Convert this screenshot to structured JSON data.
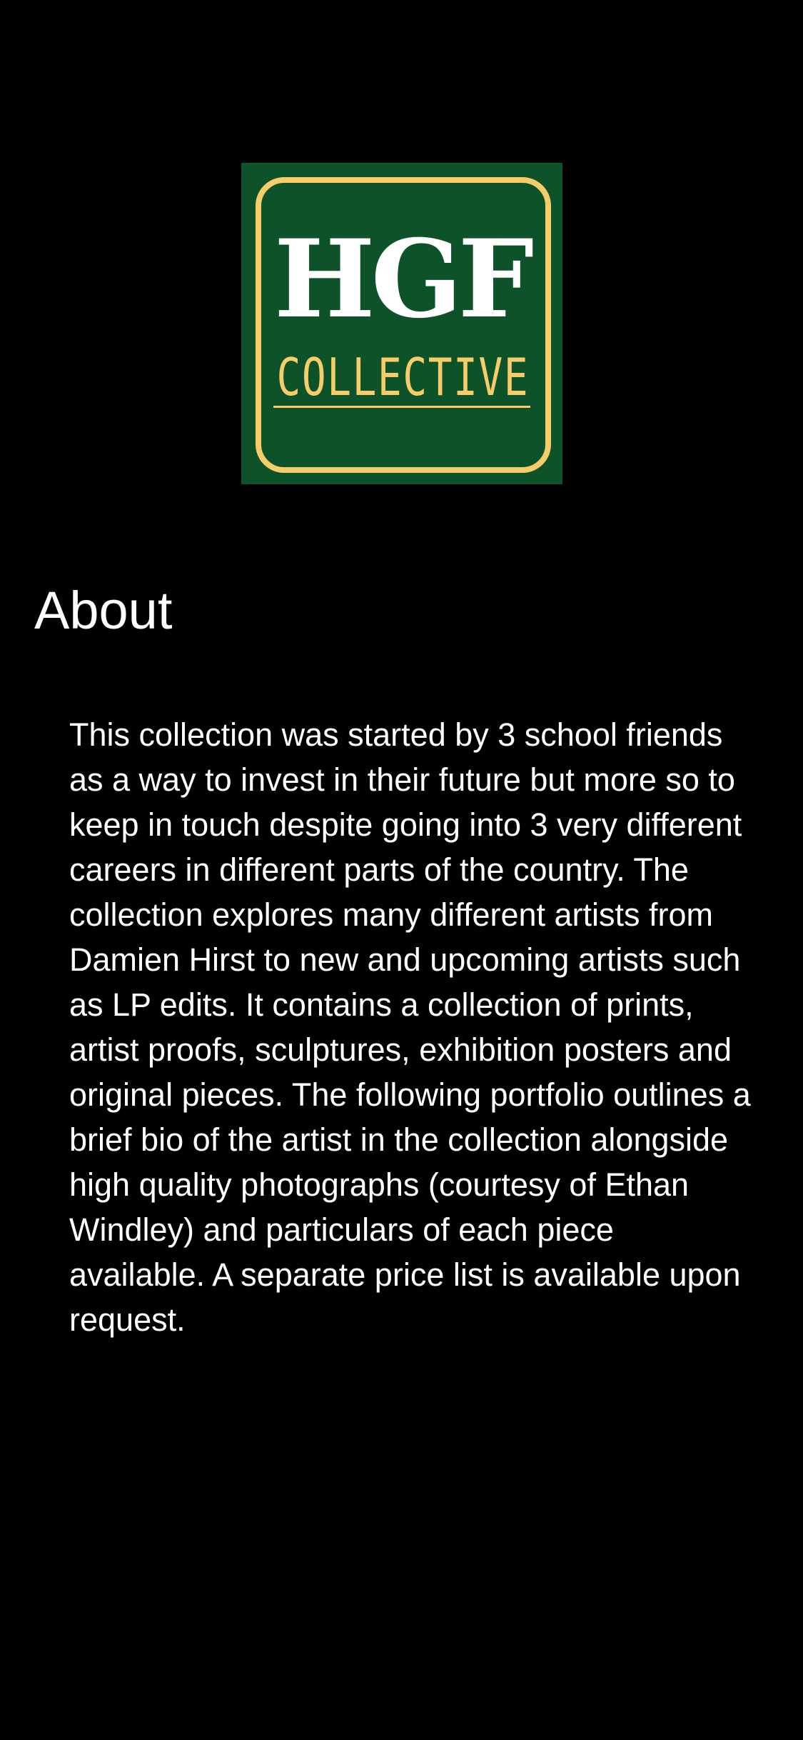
{
  "logo": {
    "main_text": "HGF",
    "sub_text": "COLLECTIVE",
    "colors": {
      "background": "#0d5229",
      "accent": "#f7cd6a",
      "text": "#ffffff"
    }
  },
  "about": {
    "title": "About",
    "body": "This collection was started by 3 school friends as a way to invest in their future but more so to keep in touch despite going into 3 very different careers in different parts of the country. The collection explores many different artists from Damien Hirst to new and upcoming artists such as LP edits. It contains a collection of prints, artist proofs, sculptures, exhibition posters and original pieces. The following portfolio outlines a brief bio of the artist in the collection alongside high quality photographs (courtesy of Ethan Windley) and particulars of each piece available. A separate price list is available upon request."
  },
  "theme": {
    "page_background": "#000000",
    "text_color": "#ffffff"
  }
}
